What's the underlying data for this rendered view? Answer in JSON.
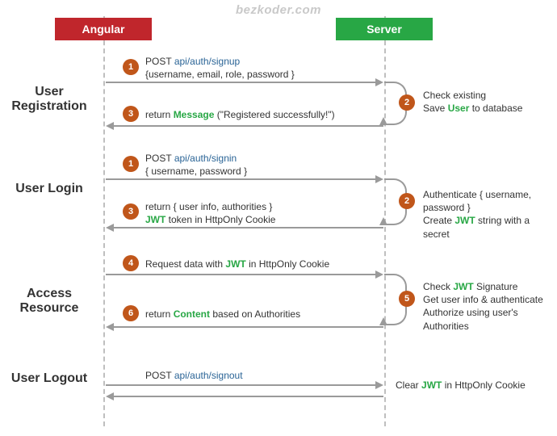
{
  "watermark": "bezkoder.com",
  "actors": {
    "client": "Angular",
    "server": "Server"
  },
  "sections": {
    "registration": "User Registration",
    "login": "User Login",
    "access": "Access Resource",
    "logout": "User Logout"
  },
  "steps": {
    "reg_req_method": "POST",
    "reg_req_api": "api/auth/signup",
    "reg_req_body": "{username, email, role, password }",
    "reg_srv_a": "Check existing",
    "reg_srv_b_pre": "Save ",
    "reg_srv_b_kw": "User",
    "reg_srv_b_post": " to database",
    "reg_res_pre": "return ",
    "reg_res_kw": "Message",
    "reg_res_post": " (\"Registered successfully!\")",
    "login_req_method": "POST",
    "login_req_api": "api/auth/signin",
    "login_req_body": "{ username, password }",
    "login_srv_a": "Authenticate { username, password }",
    "login_srv_b_pre": "Create ",
    "login_srv_b_kw": "JWT",
    "login_srv_b_post": " string with a secret",
    "login_res_line1": "return { user info, authorities }",
    "login_res_kw": "JWT",
    "login_res_post": " token in HttpOnly Cookie",
    "access_req_pre": "Request data with ",
    "access_req_kw": "JWT",
    "access_req_post": " in HttpOnly Cookie",
    "access_srv_a_pre": "Check ",
    "access_srv_a_kw": "JWT",
    "access_srv_a_post": " Signature",
    "access_srv_b": "Get user info & authenticate",
    "access_srv_c": "Authorize using user's Authorities",
    "access_res_pre": "return ",
    "access_res_kw": "Content",
    "access_res_post": " based on Authorities",
    "logout_req_method": "POST",
    "logout_req_api": "api/auth/signout",
    "logout_srv_pre": "Clear ",
    "logout_srv_kw": "JWT",
    "logout_srv_post": " in HttpOnly Cookie"
  },
  "badges": {
    "b1": "1",
    "b2": "2",
    "b3": "3",
    "b4": "4",
    "b5": "5",
    "b6": "6"
  }
}
